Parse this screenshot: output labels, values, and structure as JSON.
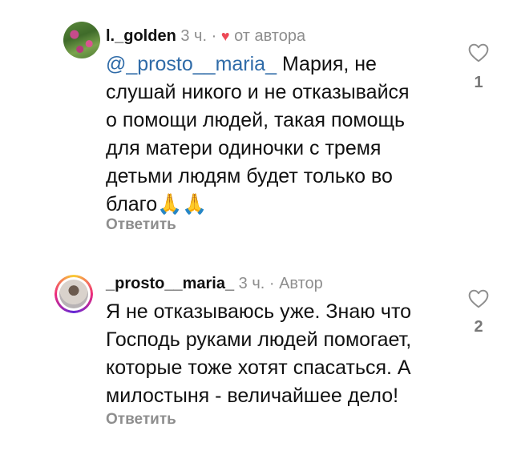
{
  "comments": [
    {
      "username": "l._golden",
      "time": "3 ч.",
      "separator": "·",
      "heart": "♥",
      "badge": "от автора",
      "mention": "@_prosto__maria_",
      "lines": [
        " Мария, не",
        "слушай никого и не отказывайся",
        "о помощи людей, такая помощь",
        "для матери одиночки с тремя",
        "детьми людям будет только во",
        "благо🙏🙏"
      ],
      "reply": "Ответить",
      "likes": "1"
    },
    {
      "username": "_prosto__maria_",
      "time": "3 ч.",
      "separator": "·",
      "badge": "Автор",
      "lines": [
        "Я не отказываюсь уже. Знаю что",
        "Господь руками людей помогает,",
        "которые тоже хотят спасаться. А",
        "милостыня - величайшее дело!"
      ],
      "reply": "Ответить",
      "likes": "2"
    }
  ],
  "colors": {
    "text": "#111111",
    "secondary": "#8e8e8e",
    "mention": "#2f6ba8",
    "heart": "#ed4956"
  },
  "icons": {
    "like": "heart-outline-icon",
    "author_like": "heart-filled-icon"
  }
}
